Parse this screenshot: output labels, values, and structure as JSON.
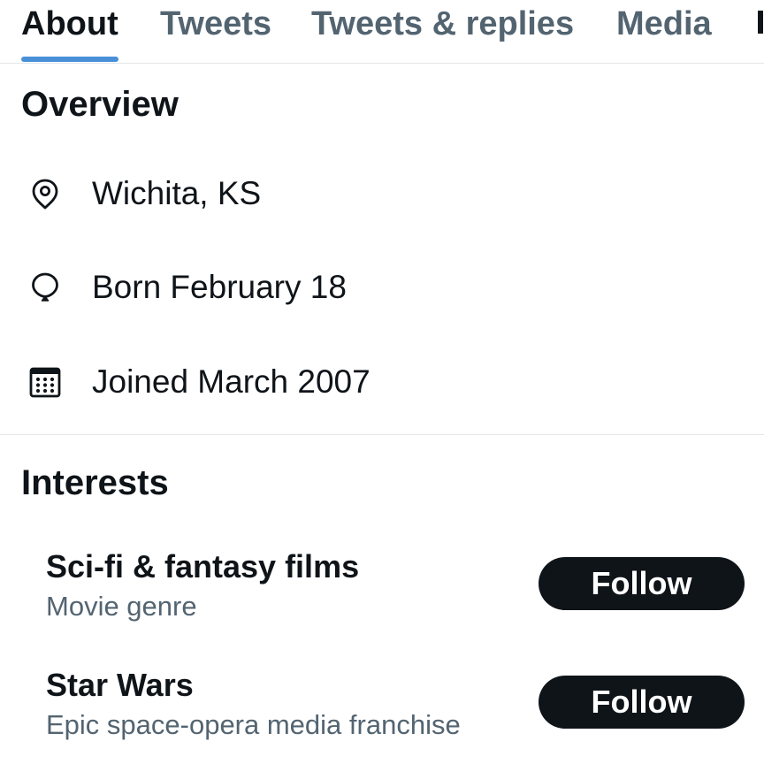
{
  "tabs": [
    {
      "label": "About",
      "active": true
    },
    {
      "label": "Tweets",
      "active": false
    },
    {
      "label": "Tweets & replies",
      "active": false
    },
    {
      "label": "Media",
      "active": false
    }
  ],
  "overview": {
    "title": "Overview",
    "items": [
      {
        "icon": "location-pin-icon",
        "text": "Wichita, KS"
      },
      {
        "icon": "balloon-icon",
        "text": "Born February 18"
      },
      {
        "icon": "calendar-icon",
        "text": "Joined March 2007"
      }
    ]
  },
  "interests": {
    "title": "Interests",
    "items": [
      {
        "name": "Sci-fi & fantasy films",
        "description": "Movie genre",
        "button": "Follow"
      },
      {
        "name": "Star Wars",
        "description": "Epic space-opera media franchise",
        "button": "Follow"
      }
    ]
  },
  "colors": {
    "primary_text": "#0f1419",
    "secondary_text": "#536471",
    "accent": "#4a90d9",
    "button_bg": "#0f1419",
    "divider": "#e4e7ea"
  }
}
